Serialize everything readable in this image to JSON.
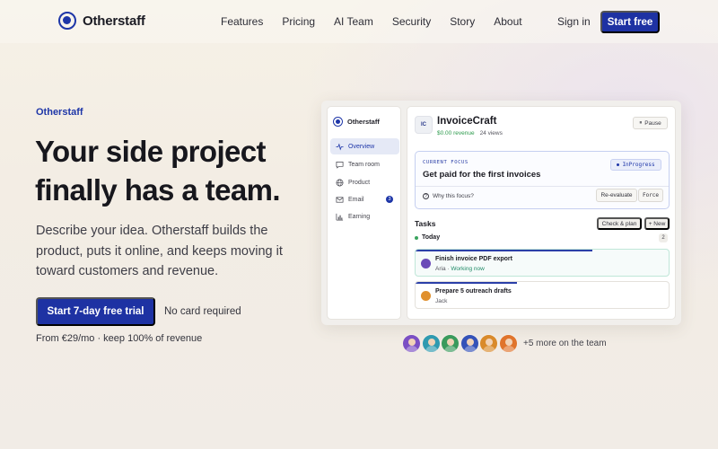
{
  "brand": {
    "name": "Otherstaff",
    "accent": "#1e32a3"
  },
  "nav": {
    "items": [
      "Features",
      "Pricing",
      "AI Team",
      "Security",
      "Story",
      "About"
    ],
    "sign_in": "Sign in",
    "start_free": "Start free"
  },
  "hero": {
    "eyebrow": "Otherstaff",
    "title": "Your side project finally has a team.",
    "description": "Describe your idea. Otherstaff builds the product, puts it online, and keeps moving it toward customers and revenue.",
    "cta": "Start 7-day free trial",
    "no_card": "No card required",
    "pricing": "From €29/mo · keep 100% of revenue"
  },
  "app": {
    "brand": "Otherstaff",
    "sidebar": [
      {
        "label": "Overview",
        "icon": "activity-icon",
        "active": true
      },
      {
        "label": "Team room",
        "icon": "chat-icon",
        "active": false
      },
      {
        "label": "Product",
        "icon": "globe-icon",
        "active": false
      },
      {
        "label": "Email",
        "icon": "mail-icon",
        "active": false,
        "badge": "3"
      },
      {
        "label": "Earning",
        "icon": "bar-chart-icon",
        "active": false
      }
    ],
    "project": {
      "initials": "IC",
      "name": "InvoiceCraft",
      "revenue": "$0.00 revenue",
      "views": "24 views",
      "pause": "Pause"
    },
    "focus": {
      "label": "CURRENT FOCUS",
      "title": "Get paid for the first invoices",
      "status": "InProgress",
      "why": "Why this focus?",
      "reevaluate": "Re-evaluate",
      "force": "Force"
    },
    "tasks": {
      "title": "Tasks",
      "check_plan": "Check & plan",
      "new": "+ New",
      "group": "Today",
      "count": "2",
      "items": [
        {
          "title": "Finish invoice PDF export",
          "assignee": "Aria",
          "status": "Working now",
          "progress": 0.7
        },
        {
          "title": "Prepare 5 outreach drafts",
          "assignee": "Jack",
          "status": "",
          "progress": 0.4
        }
      ]
    }
  },
  "team": {
    "more": "+5 more on the team",
    "avatar_colors": [
      "#7b4fc4",
      "#2f9ab0",
      "#3a9a5c",
      "#3552b8",
      "#d98a2b",
      "#e0742c"
    ]
  }
}
